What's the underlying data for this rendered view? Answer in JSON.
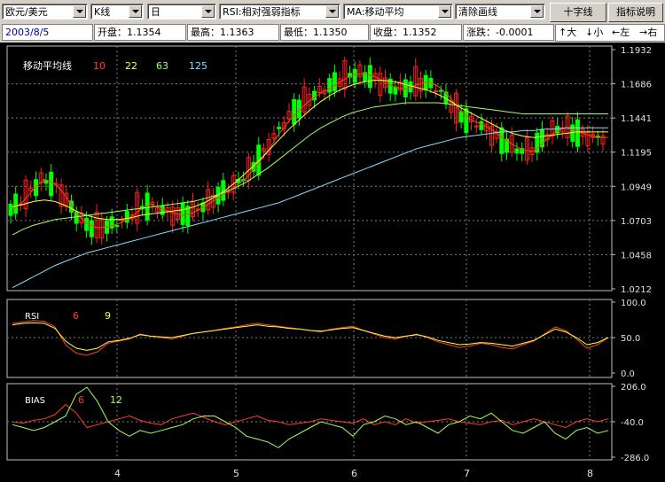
{
  "toolbar": {
    "symbol": "欧元/美元",
    "chart_type": "K线",
    "period": "日",
    "indicator": "RSI:相对强弱指标",
    "overlay": "MA:移动平均",
    "draw": "清除画线",
    "crosshair_button": "十字线",
    "help_button": "指标说明"
  },
  "info": {
    "date": "2003/8/5",
    "open": "开盘：1.1354",
    "high": "最高：1.1363",
    "low": "最低：1.1350",
    "close": "收盘：1.1352",
    "change": "涨跌：-0.0001"
  },
  "nav": {
    "bigger": "↑大",
    "smaller": "↓小",
    "left": "←左",
    "right": "→右"
  },
  "colors": {
    "up": "#ff2020",
    "down": "#00ff00",
    "ma10": "#ff4020",
    "ma22": "#ffff40",
    "ma63": "#a0ff60",
    "ma125": "#80e0ff",
    "grid": "#808080"
  },
  "chart_data": [
    {
      "type": "candlestick",
      "title": "移动平均线",
      "legend": [
        "10",
        "22",
        "63",
        "125"
      ],
      "y_ticks": [
        "1.1932",
        "1.1686",
        "1.1441",
        "1.1195",
        "1.0949",
        "1.0703",
        "1.0458",
        "1.0212"
      ],
      "ylim": [
        1.0212,
        1.1932
      ],
      "x_ticks": [
        "4",
        "5",
        "6",
        "7",
        "8"
      ],
      "series": [
        {
          "name": "10",
          "values": [
            1.078,
            1.084,
            1.093,
            1.1,
            1.097,
            1.088,
            1.076,
            1.068,
            1.065,
            1.066,
            1.068,
            1.072,
            1.078,
            1.082,
            1.079,
            1.076,
            1.074,
            1.076,
            1.08,
            1.085,
            1.09,
            1.095,
            1.101,
            1.11,
            1.12,
            1.132,
            1.142,
            1.15,
            1.157,
            1.162,
            1.166,
            1.171,
            1.175,
            1.176,
            1.174,
            1.17,
            1.166,
            1.165,
            1.168,
            1.17,
            1.167,
            1.16,
            1.15,
            1.143,
            1.14,
            1.136,
            1.13,
            1.125,
            1.121,
            1.12,
            1.127,
            1.134,
            1.137,
            1.135,
            1.132,
            1.13,
            1.13
          ]
        },
        {
          "name": "22",
          "values": [
            1.08,
            1.082,
            1.084,
            1.085,
            1.084,
            1.081,
            1.077,
            1.074,
            1.072,
            1.071,
            1.071,
            1.072,
            1.074,
            1.075,
            1.076,
            1.077,
            1.078,
            1.08,
            1.083,
            1.087,
            1.092,
            1.098,
            1.105,
            1.112,
            1.12,
            1.128,
            1.136,
            1.143,
            1.15,
            1.156,
            1.161,
            1.165,
            1.168,
            1.17,
            1.171,
            1.171,
            1.17,
            1.168,
            1.166,
            1.164,
            1.161,
            1.157,
            1.152,
            1.148,
            1.144,
            1.14,
            1.136,
            1.133,
            1.131,
            1.13,
            1.131,
            1.132,
            1.133,
            1.134,
            1.134,
            1.134,
            1.134
          ]
        },
        {
          "name": "63",
          "values": [
            1.06,
            1.064,
            1.067,
            1.069,
            1.071,
            1.072,
            1.073,
            1.074,
            1.075,
            1.076,
            1.077,
            1.078,
            1.079,
            1.08,
            1.081,
            1.082,
            1.083,
            1.084,
            1.086,
            1.088,
            1.091,
            1.094,
            1.098,
            1.103,
            1.108,
            1.114,
            1.12,
            1.126,
            1.132,
            1.137,
            1.141,
            1.145,
            1.148,
            1.15,
            1.152,
            1.153,
            1.154,
            1.155,
            1.155,
            1.155,
            1.155,
            1.154,
            1.153,
            1.152,
            1.151,
            1.15,
            1.149,
            1.148,
            1.147,
            1.147,
            1.147,
            1.147,
            1.147,
            1.147,
            1.147,
            1.147,
            1.147
          ]
        },
        {
          "name": "125",
          "values": [
            1.022,
            1.026,
            1.03,
            1.034,
            1.038,
            1.041,
            1.044,
            1.047,
            1.049,
            1.051,
            1.053,
            1.055,
            1.057,
            1.059,
            1.061,
            1.063,
            1.065,
            1.067,
            1.069,
            1.071,
            1.073,
            1.075,
            1.077,
            1.079,
            1.081,
            1.083,
            1.086,
            1.089,
            1.092,
            1.095,
            1.098,
            1.101,
            1.104,
            1.107,
            1.11,
            1.113,
            1.116,
            1.119,
            1.122,
            1.124,
            1.126,
            1.128,
            1.13,
            1.131,
            1.132,
            1.133,
            1.134,
            1.134,
            1.135,
            1.135,
            1.136,
            1.136,
            1.137,
            1.137,
            1.137,
            1.137,
            1.137
          ]
        }
      ]
    },
    {
      "type": "line",
      "title": "RSI",
      "legend": [
        "6",
        "9"
      ],
      "y_ticks": [
        "100.0",
        "50.0",
        "0.0"
      ],
      "ylim": [
        0,
        100
      ],
      "series": [
        {
          "name": "6",
          "values": [
            70,
            72,
            74,
            73,
            65,
            40,
            28,
            25,
            30,
            42,
            45,
            48,
            55,
            52,
            50,
            48,
            52,
            56,
            58,
            60,
            63,
            65,
            68,
            70,
            68,
            66,
            64,
            62,
            60,
            58,
            62,
            64,
            66,
            60,
            55,
            50,
            48,
            52,
            55,
            50,
            44,
            40,
            36,
            38,
            42,
            40,
            36,
            34,
            40,
            45,
            55,
            65,
            60,
            48,
            35,
            40,
            50
          ]
        },
        {
          "name": "9",
          "values": [
            68,
            70,
            71,
            70,
            63,
            45,
            35,
            32,
            35,
            44,
            46,
            49,
            54,
            52,
            51,
            50,
            53,
            56,
            58,
            60,
            62,
            64,
            66,
            68,
            66,
            65,
            63,
            62,
            60,
            59,
            61,
            63,
            64,
            60,
            56,
            52,
            50,
            52,
            54,
            51,
            46,
            43,
            40,
            41,
            43,
            42,
            40,
            38,
            42,
            46,
            54,
            62,
            58,
            50,
            40,
            43,
            50
          ]
        }
      ]
    },
    {
      "type": "line",
      "title": "BIAS",
      "legend": [
        "6",
        "12"
      ],
      "y_ticks": [
        "206.0",
        "-40.0",
        "-286.0"
      ],
      "ylim": [
        -286,
        206
      ],
      "series": [
        {
          "name": "6",
          "values": [
            -40,
            -50,
            -30,
            -20,
            10,
            80,
            20,
            -80,
            -60,
            -40,
            -20,
            0,
            -30,
            -50,
            -60,
            -20,
            0,
            20,
            -10,
            -40,
            -60,
            -40,
            -20,
            0,
            -30,
            -40,
            -60,
            -50,
            -40,
            -20,
            -30,
            -40,
            -50,
            -20,
            -60,
            -40,
            -60,
            -20,
            -50,
            -40,
            -30,
            -20,
            -40,
            -50,
            -60,
            -40,
            -30,
            -60,
            -40,
            -20,
            -40,
            -60,
            -80,
            -40,
            -20,
            -40,
            -20
          ]
        },
        {
          "name": "12",
          "values": [
            -60,
            -80,
            -100,
            -80,
            -40,
            0,
            150,
            200,
            100,
            -40,
            -100,
            -140,
            -100,
            -120,
            -100,
            -80,
            -60,
            -20,
            0,
            0,
            -40,
            -80,
            -140,
            -160,
            -180,
            -220,
            -160,
            -120,
            -80,
            -40,
            -60,
            -80,
            -140,
            -60,
            -40,
            0,
            -20,
            -60,
            -40,
            -80,
            -120,
            -60,
            -40,
            0,
            -20,
            20,
            -40,
            -100,
            -120,
            -80,
            -40,
            -120,
            -160,
            -100,
            -80,
            -120,
            -100
          ]
        }
      ]
    }
  ]
}
